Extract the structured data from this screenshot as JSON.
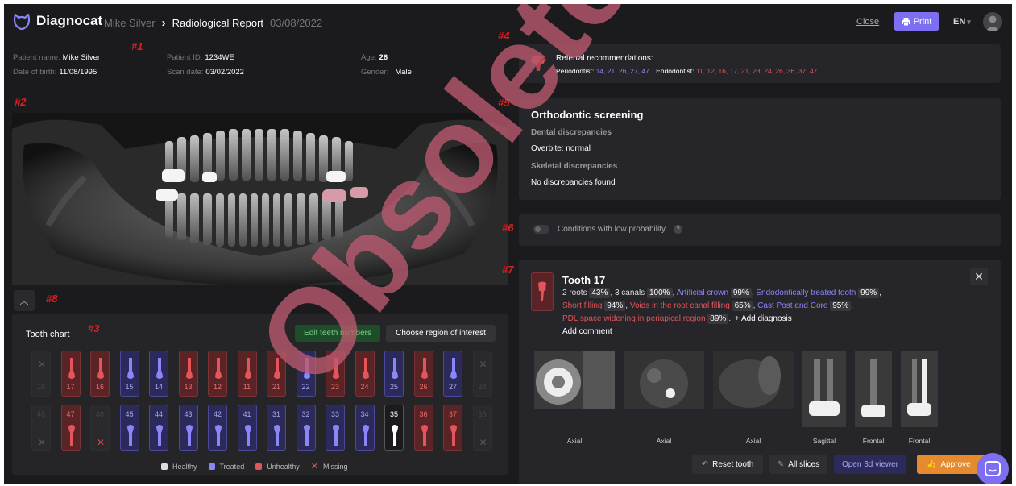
{
  "app": {
    "name": "Diagnocat"
  },
  "breadcrumb": {
    "patient": "Mike Silver",
    "separator": "›",
    "report": "Radiological Report",
    "date": "03/08/2022"
  },
  "header": {
    "close_label": "Close",
    "print_label": "Print",
    "language": "EN"
  },
  "patient": {
    "name_label": "Patient name:",
    "name": "Mike Silver",
    "dob_label": "Date of birth:",
    "dob": "11/08/1995",
    "id_label": "Patient ID:",
    "id": "1234WE",
    "scan_label": "Scan date:",
    "scan": "03/02/2022",
    "age_label": "Age:",
    "age": "26",
    "gender_label": "Gender:",
    "gender": "Male"
  },
  "annotations": [
    "#1",
    "#2",
    "#3",
    "#4",
    "#5",
    "#6",
    "#7",
    "#8"
  ],
  "watermark": "Obsolete",
  "tooth_chart": {
    "title": "Tooth chart",
    "edit_label": "Edit teeth numbers",
    "region_label": "Choose region of interest",
    "upper": [
      {
        "num": "18",
        "status": "missing"
      },
      {
        "num": "17",
        "status": "unhealthy"
      },
      {
        "num": "16",
        "status": "unhealthy"
      },
      {
        "num": "15",
        "status": "treated"
      },
      {
        "num": "14",
        "status": "treated"
      },
      {
        "num": "13",
        "status": "unhealthy"
      },
      {
        "num": "12",
        "status": "unhealthy"
      },
      {
        "num": "11",
        "status": "unhealthy"
      },
      {
        "num": "21",
        "status": "unhealthy"
      },
      {
        "num": "22",
        "status": "treated"
      },
      {
        "num": "23",
        "status": "unhealthy"
      },
      {
        "num": "24",
        "status": "unhealthy"
      },
      {
        "num": "25",
        "status": "treated"
      },
      {
        "num": "26",
        "status": "unhealthy"
      },
      {
        "num": "27",
        "status": "treated"
      },
      {
        "num": "28",
        "status": "missing"
      }
    ],
    "lower": [
      {
        "num": "48",
        "status": "missing"
      },
      {
        "num": "47",
        "status": "unhealthy"
      },
      {
        "num": "46",
        "status": "missing-red"
      },
      {
        "num": "45",
        "status": "treated"
      },
      {
        "num": "44",
        "status": "treated"
      },
      {
        "num": "43",
        "status": "treated"
      },
      {
        "num": "42",
        "status": "treated"
      },
      {
        "num": "41",
        "status": "treated"
      },
      {
        "num": "31",
        "status": "treated"
      },
      {
        "num": "32",
        "status": "treated"
      },
      {
        "num": "33",
        "status": "treated"
      },
      {
        "num": "34",
        "status": "treated"
      },
      {
        "num": "35",
        "status": "healthy"
      },
      {
        "num": "36",
        "status": "unhealthy"
      },
      {
        "num": "37",
        "status": "unhealthy"
      },
      {
        "num": "38",
        "status": "missing"
      }
    ],
    "legend": {
      "healthy": "Healthy",
      "treated": "Treated",
      "unhealthy": "Unhealthy",
      "missing": "Missing"
    }
  },
  "referral": {
    "title": "Referral recommendations:",
    "periodontist_label": "Periodontist:",
    "periodontist": "14, 21, 26, 27, 47",
    "endodontist_label": "Endodontist:",
    "endodontist": "11, 12, 16, 17, 21, 23, 24, 26, 36, 37, 47"
  },
  "orthodontic": {
    "title": "Orthodontic screening",
    "dental_label": "Dental discrepancies",
    "dental_value": "Overbite: normal",
    "skeletal_label": "Skeletal discrepancies",
    "skeletal_value": "No discrepancies found"
  },
  "conditions": {
    "label": "Conditions with low probability",
    "help": "?"
  },
  "tooth_detail": {
    "title": "Tooth 17",
    "roots": "2 roots",
    "roots_pct": "43%",
    "canals": "3 canals",
    "canals_pct": "100%",
    "crown": "Artificial crown",
    "crown_pct": "99%",
    "endo": "Endodontically treated tooth",
    "endo_pct": "99%",
    "short": "Short filling",
    "short_pct": "94%",
    "voids": "Voids in the root canal filling",
    "voids_pct": "65%",
    "post": "Cast Post and Core",
    "post_pct": "95%",
    "pdl": "PDL space widening in periapical region",
    "pdl_pct": "89%",
    "add_diagnosis": "+ Add diagnosis",
    "add_comment": "Add comment",
    "slices": [
      "Axial",
      "Axial",
      "Axial",
      "Sagittal",
      "Frontal",
      "Frontal"
    ],
    "reset_label": "Reset tooth",
    "all_slices_label": "All slices",
    "viewer_label": "Open 3d viewer",
    "approve_label": "Approve"
  },
  "colors": {
    "accent": "#7d6ef2",
    "unhealthy": "#e2555a",
    "treated": "#8a86f7",
    "green": "#7ccf8a",
    "approve": "#e58a2e"
  }
}
